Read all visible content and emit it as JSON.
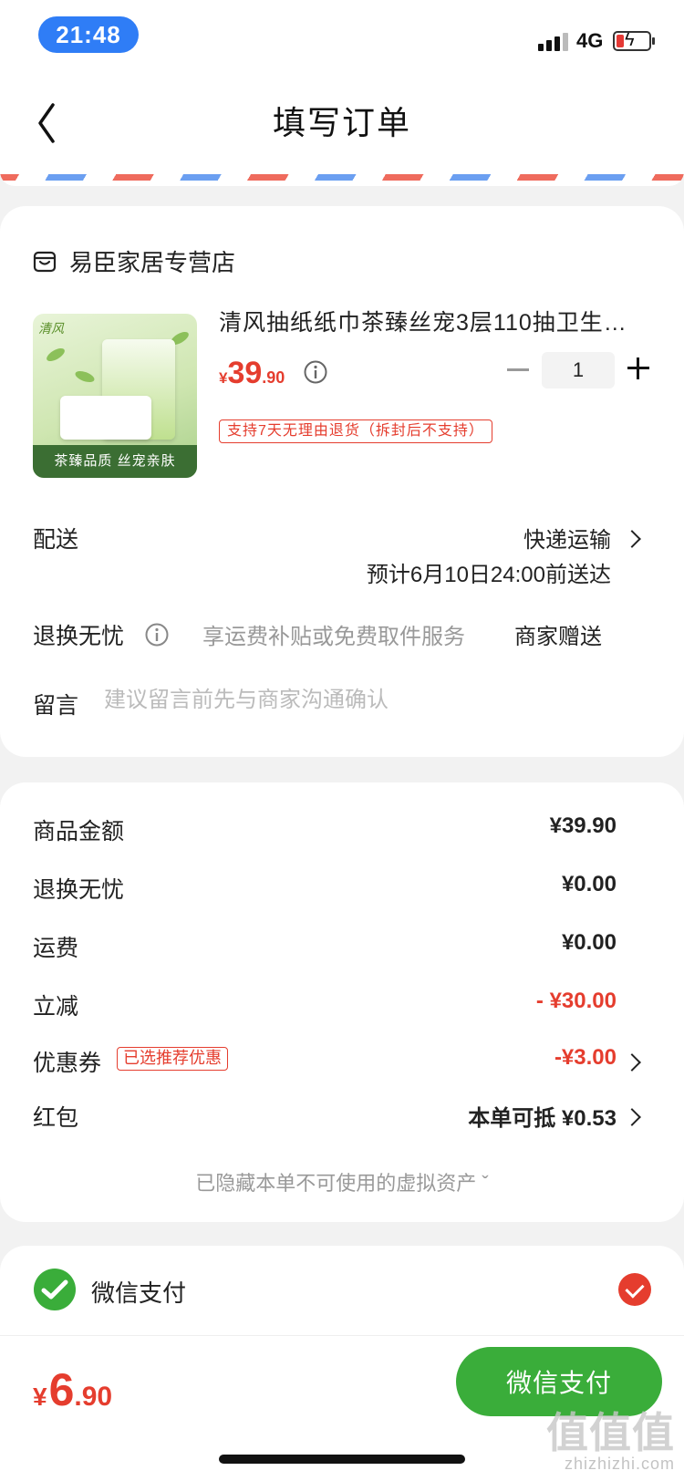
{
  "status_bar": {
    "time": "21:48",
    "network": "4G"
  },
  "nav": {
    "title": "填写订单"
  },
  "store": {
    "name": "易臣家居专营店"
  },
  "product": {
    "title": "清风抽纸纸巾茶臻丝宠3层110抽卫生…",
    "price_symbol": "¥",
    "price_int": "39",
    "price_dec": ".90",
    "quantity": "1",
    "return_tag": "支持7天无理由退货（拆封后不支持）",
    "image_tagline": "茶臻品质 丝宠亲肤",
    "image_brand": "清风"
  },
  "delivery": {
    "label": "配送",
    "method": "快递运输",
    "eta": "预计6月10日24:00前送达"
  },
  "worry_free": {
    "label": "退换无忧",
    "desc": "享运费补贴或免费取件服务",
    "gift": "商家赠送"
  },
  "note": {
    "label": "留言",
    "placeholder": "建议留言前先与商家沟通确认"
  },
  "costs": {
    "goods": {
      "label": "商品金额",
      "value": "¥39.90"
    },
    "worry": {
      "label": "退换无忧",
      "value": "¥0.00"
    },
    "shipping": {
      "label": "运费",
      "value": "¥0.00"
    },
    "discount": {
      "label": "立减",
      "value": "- ¥30.00"
    },
    "coupon": {
      "label": "优惠券",
      "tag": "已选推荐优惠",
      "value": "-¥3.00"
    },
    "red_packet": {
      "label": "红包",
      "value": "本单可抵 ¥0.53"
    },
    "hidden_note": "已隐藏本单不可使用的虚拟资产 ˇ"
  },
  "payment": {
    "method": "微信支付"
  },
  "footer": {
    "total_symbol": "¥",
    "total_int": "6",
    "total_dec": ".90",
    "pay_button": "微信支付",
    "watermark_big": "值值值",
    "watermark_small": "zhizhizhi.com"
  },
  "colors": {
    "accent_red": "#e53d2e",
    "pay_green": "#3aad3a",
    "time_pill_blue": "#2f7df6"
  }
}
